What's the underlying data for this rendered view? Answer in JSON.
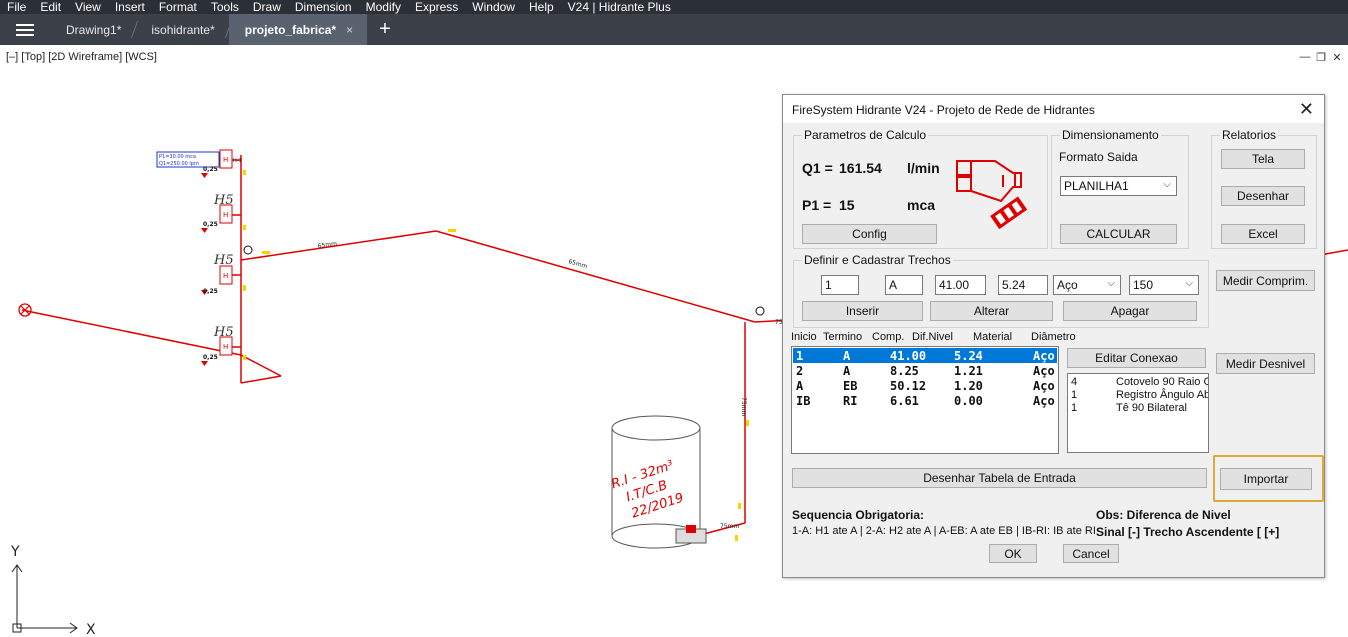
{
  "menu": [
    "File",
    "Edit",
    "View",
    "Insert",
    "Format",
    "Tools",
    "Draw",
    "Dimension",
    "Modify",
    "Express",
    "Window",
    "Help",
    "V24 | Hidrante Plus"
  ],
  "tabs": [
    {
      "label": "Drawing1*"
    },
    {
      "label": "isohidrante*"
    },
    {
      "label": "projeto_fabrica*",
      "close": "×"
    }
  ],
  "viewport": {
    "label": "[–] [Top] [2D Wireframe] [WCS]"
  },
  "drawing": {
    "hydrants": [
      "H5",
      "H5",
      "H5"
    ],
    "legend_lines": [
      "P1=30.00 mca",
      "Q1=250.00 lpm"
    ],
    "h1_label": "H-1",
    "values": [
      "0,25",
      "0,25",
      "0,25",
      "0,25"
    ],
    "pipe_labels": [
      "65mm",
      "65mm",
      "75mm",
      "75mm",
      "75mm"
    ],
    "tank_text": [
      "R.I - 32m³",
      "I.T/C.B",
      "22/2019"
    ],
    "axis_y": "Y",
    "axis_x": "X"
  },
  "dialog": {
    "title": "FireSystem Hidrante V24 - Projeto de Rede de Hidrantes",
    "parametros": {
      "title": "Parametros de Calculo",
      "q1_label": "Q1 =",
      "q1_value": "161.54",
      "q1_unit": "l/min",
      "p1_label": "P1 =",
      "p1_value": "15",
      "p1_unit": "mca",
      "config": "Config"
    },
    "dimensionamento": {
      "title": "Dimensionamento",
      "formato_label": "Formato Saida",
      "formato_value": "PLANILHA1",
      "calcular": "CALCULAR"
    },
    "relatorios": {
      "title": "Relatorios",
      "tela": "Tela",
      "desenhar": "Desenhar",
      "excel": "Excel"
    },
    "trechos": {
      "title": "Definir e Cadastrar Trechos",
      "inicio": "1",
      "termino": "A",
      "comp": "41.00",
      "dif": "5.24",
      "material": "Aço",
      "diametro": "150",
      "inserir": "Inserir",
      "alterar": "Alterar",
      "apagar": "Apagar"
    },
    "medir_comprim": "Medir Comprim.",
    "medir_desnivel": "Medir Desnivel",
    "table": {
      "headers": [
        "Inicio",
        "Termino",
        "Comp.",
        "Dif.Nivel",
        "Material",
        "Diâmetro"
      ],
      "rows": [
        [
          "1",
          "A",
          "41.00",
          "5.24",
          "Aço"
        ],
        [
          "2",
          "A",
          "8.25",
          "1.21",
          "Aço"
        ],
        [
          "A",
          "EB",
          "50.12",
          "1.20",
          "Aço"
        ],
        [
          "IB",
          "RI",
          "6.61",
          "0.00",
          "Aço"
        ]
      ]
    },
    "editar_conexao": "Editar Conexao",
    "conexoes": [
      [
        "4",
        "Cotovelo 90 Raio C"
      ],
      [
        "1",
        "Registro Ângulo Ab"
      ],
      [
        "1",
        "Tê 90 Bilateral"
      ]
    ],
    "desenhar_tabela": "Desenhar Tabela de Entrada",
    "importar": "Importar",
    "sequencia_title": "Sequencia Obrigatoria:",
    "sequencia_text": "1-A: H1 ate A | 2-A: H2 ate A | A-EB: A ate EB | IB-RI: IB ate RI",
    "obs_title": "Obs: Diferenca de Nivel",
    "obs_text": "Sinal [-] Trecho Ascendente [ [+]",
    "ok": "OK",
    "cancel": "Cancel"
  }
}
